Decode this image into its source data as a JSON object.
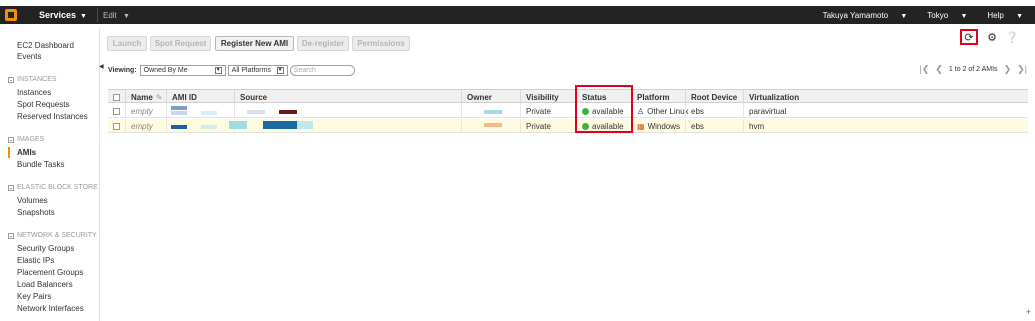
{
  "topbar": {
    "services_label": "Services",
    "edit_label": "Edit",
    "user_name": "Takuya Yamamoto",
    "region": "Tokyo",
    "help": "Help"
  },
  "sidebar": {
    "top_links": [
      "EC2 Dashboard",
      "Events"
    ],
    "sections": [
      {
        "title": "INSTANCES",
        "items": [
          "Instances",
          "Spot Requests",
          "Reserved Instances"
        ]
      },
      {
        "title": "IMAGES",
        "items": [
          "AMIs",
          "Bundle Tasks"
        ]
      },
      {
        "title": "ELASTIC BLOCK STORE",
        "items": [
          "Volumes",
          "Snapshots"
        ]
      },
      {
        "title": "NETWORK & SECURITY",
        "items": [
          "Security Groups",
          "Elastic IPs",
          "Placement Groups",
          "Load Balancers",
          "Key Pairs",
          "Network Interfaces"
        ]
      }
    ],
    "active_item": "AMIs"
  },
  "toolbar": {
    "launch": "Launch",
    "spot_request": "Spot Request",
    "register": "Register New AMI",
    "deregister": "De-register",
    "permissions": "Permissions"
  },
  "filters": {
    "viewing_label": "Viewing:",
    "owner_filter": "Owned By Me",
    "platform_filter": "All Platforms",
    "search_placeholder": "Search"
  },
  "pager": {
    "summary": "1 to 2 of 2 AMIs"
  },
  "table": {
    "columns": [
      "Name",
      "AMI ID",
      "Source",
      "Owner",
      "Visibility",
      "Status",
      "Platform",
      "Root Device",
      "Virtualization"
    ],
    "rows": [
      {
        "name": "empty",
        "visibility": "Private",
        "status": "available",
        "platform": "Other Linux",
        "root_device": "ebs",
        "virtualization": "paravirtual"
      },
      {
        "name": "empty",
        "visibility": "Private",
        "status": "available",
        "platform": "Windows",
        "root_device": "ebs",
        "virtualization": "hvm"
      }
    ]
  },
  "colors": {
    "accent": "#f29000",
    "highlight": "#e0001b",
    "status_ok": "#3bb33b"
  }
}
